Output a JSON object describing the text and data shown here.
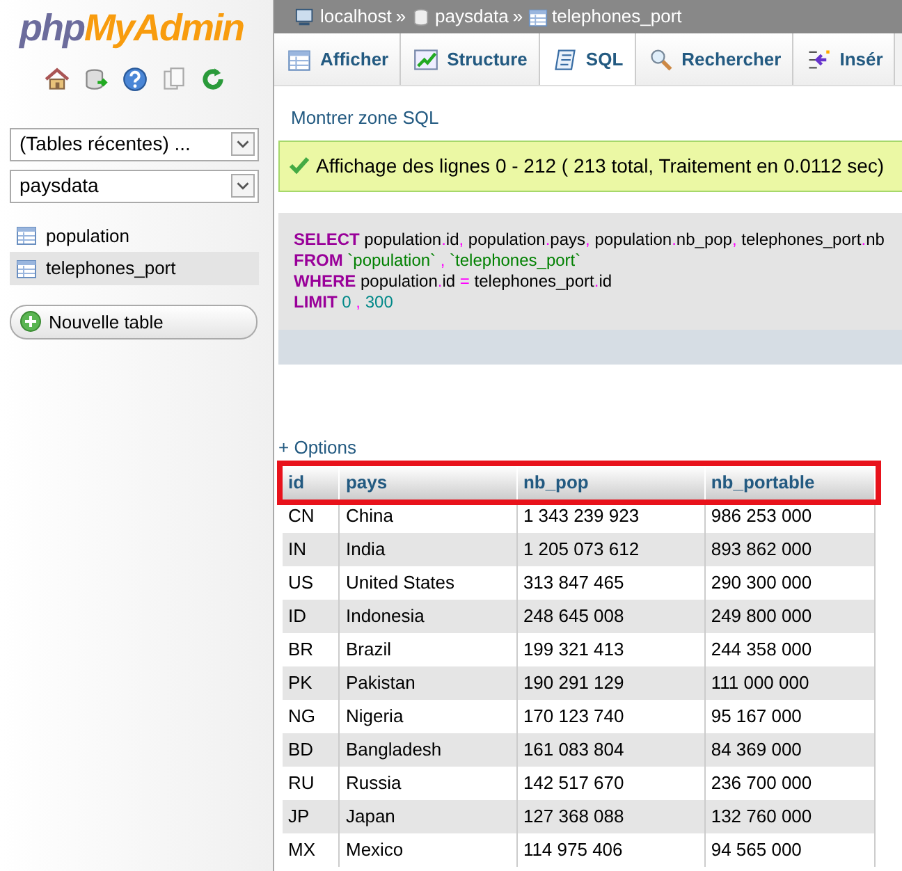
{
  "sidebar": {
    "logo": {
      "part1": "php",
      "part2": "MyAdmin"
    },
    "selects": [
      {
        "value": "(Tables récentes) ..."
      },
      {
        "value": "paysdata"
      }
    ],
    "tables": [
      {
        "label": "population",
        "selected": false
      },
      {
        "label": "telephones_port",
        "selected": true
      }
    ],
    "new_table_button": "Nouvelle table"
  },
  "breadcrumb": [
    {
      "kind": "server",
      "label": "localhost"
    },
    {
      "kind": "database",
      "label": "paysdata"
    },
    {
      "kind": "table",
      "label": "telephones_port"
    }
  ],
  "breadcrumb_separator": "»",
  "tabs": [
    {
      "kind": "browse",
      "label": "Afficher",
      "selected": false
    },
    {
      "kind": "structure",
      "label": "Structure",
      "selected": false
    },
    {
      "kind": "sql",
      "label": "SQL",
      "selected": true
    },
    {
      "kind": "search",
      "label": "Rechercher",
      "selected": false
    },
    {
      "kind": "insert",
      "label": "Insér",
      "selected": false
    }
  ],
  "show_sql_link": "Montrer zone SQL",
  "success_message": "Affichage des lignes 0 - 212 ( 213 total, Traitement en 0.0112 sec)",
  "sql": [
    [
      {
        "kind": "keyword",
        "text": "SELECT"
      },
      {
        "kind": "ident",
        "text": " population"
      },
      {
        "kind": "punct",
        "text": "."
      },
      {
        "kind": "ident",
        "text": "id"
      },
      {
        "kind": "punct",
        "text": ","
      },
      {
        "kind": "ident",
        "text": " population"
      },
      {
        "kind": "punct",
        "text": "."
      },
      {
        "kind": "ident",
        "text": "pays"
      },
      {
        "kind": "punct",
        "text": ","
      },
      {
        "kind": "ident",
        "text": " population"
      },
      {
        "kind": "punct",
        "text": "."
      },
      {
        "kind": "ident",
        "text": "nb_pop"
      },
      {
        "kind": "punct",
        "text": ","
      },
      {
        "kind": "ident",
        "text": " telephones_port"
      },
      {
        "kind": "punct",
        "text": "."
      },
      {
        "kind": "ident",
        "text": "nb"
      }
    ],
    [
      {
        "kind": "keyword",
        "text": "FROM"
      },
      {
        "kind": "string",
        "text": " `population`"
      },
      {
        "kind": "punct",
        "text": " ,"
      },
      {
        "kind": "string",
        "text": " `telephones_port`"
      }
    ],
    [
      {
        "kind": "keyword",
        "text": "WHERE"
      },
      {
        "kind": "ident",
        "text": " population"
      },
      {
        "kind": "punct",
        "text": "."
      },
      {
        "kind": "ident",
        "text": "id "
      },
      {
        "kind": "operator",
        "text": "="
      },
      {
        "kind": "ident",
        "text": " telephones_port"
      },
      {
        "kind": "punct",
        "text": "."
      },
      {
        "kind": "ident",
        "text": "id"
      }
    ],
    [
      {
        "kind": "keyword",
        "text": "LIMIT"
      },
      {
        "kind": "number",
        "text": " 0"
      },
      {
        "kind": "punct",
        "text": " ,"
      },
      {
        "kind": "number",
        "text": " 300"
      }
    ]
  ],
  "options_link": "+ Options",
  "table": {
    "columns": [
      "id",
      "pays",
      "nb_pop",
      "nb_portable"
    ],
    "header_highlighted": true,
    "rows": [
      [
        "CN",
        "China",
        "1 343 239 923",
        "986 253 000"
      ],
      [
        "IN",
        "India",
        "1 205 073 612",
        "893 862 000"
      ],
      [
        "US",
        "United States",
        "313 847 465",
        "290 300 000"
      ],
      [
        "ID",
        "Indonesia",
        "248 645 008",
        "249 800 000"
      ],
      [
        "BR",
        "Brazil",
        "199 321 413",
        "244 358 000"
      ],
      [
        "PK",
        "Pakistan",
        "190 291 129",
        "111 000 000"
      ],
      [
        "NG",
        "Nigeria",
        "170 123 740",
        "95 167 000"
      ],
      [
        "BD",
        "Bangladesh",
        "161 083 804",
        "84 369 000"
      ],
      [
        "RU",
        "Russia",
        "142 517 670",
        "236 700 000"
      ],
      [
        "JP",
        "Japan",
        "127 368 088",
        "132 760 000"
      ],
      [
        "MX",
        "Mexico",
        "114 975 406",
        "94 565 000"
      ]
    ]
  }
}
